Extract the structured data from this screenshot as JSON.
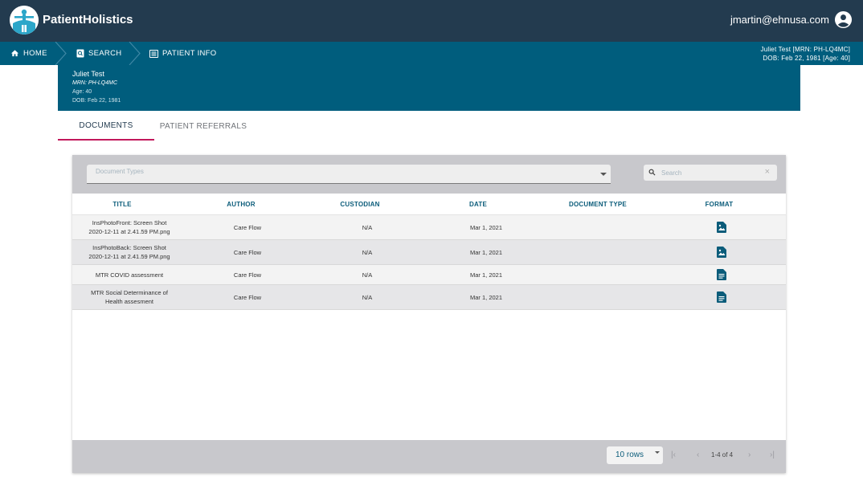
{
  "header": {
    "brand": "PatientHolistics",
    "user_email": "jmartin@ehnusa.com"
  },
  "nav": {
    "home": "HOME",
    "search": "SEARCH",
    "patient_info": "PATIENT INFO",
    "patient_line1": "Juliet Test [MRN: PH-LQ4MC]",
    "patient_line2": "DOB: Feb 22, 1981 [Age: 40]"
  },
  "patient": {
    "name": "Juliet Test",
    "mrn": "MRN: PH-LQ4MC",
    "age": "Age: 40",
    "dob": "DOB: Feb 22, 1981"
  },
  "tabs": [
    {
      "label": "DOCUMENTS",
      "active": true
    },
    {
      "label": "PATIENT REFERRALS",
      "active": false
    }
  ],
  "filters": {
    "doc_types_placeholder": "Document Types",
    "search_placeholder": "Search"
  },
  "table": {
    "columns": [
      "TITLE",
      "AUTHOR",
      "CUSTODIAN",
      "DATE",
      "DOCUMENT TYPE",
      "FORMAT"
    ],
    "rows": [
      {
        "title_1": "InsPhotoFront: Screen Shot",
        "title_2": "2020-12-11 at 2.41.59 PM.png",
        "author": "Care Flow",
        "custodian": "N/A",
        "date": "Mar 1, 2021",
        "doc_type": "",
        "format": "image-file-icon"
      },
      {
        "title_1": "InsPhotoBack: Screen Shot",
        "title_2": "2020-12-11 at 2.41.59 PM.png",
        "author": "Care Flow",
        "custodian": "N/A",
        "date": "Mar 1, 2021",
        "doc_type": "",
        "format": "image-file-icon"
      },
      {
        "title_1": "MTR COVID assessment",
        "title_2": "",
        "author": "Care Flow",
        "custodian": "N/A",
        "date": "Mar 1, 2021",
        "doc_type": "",
        "format": "document-icon"
      },
      {
        "title_1": "MTR Social Determinance of",
        "title_2": "Health assesment",
        "author": "Care Flow",
        "custodian": "N/A",
        "date": "Mar 1, 2021",
        "doc_type": "",
        "format": "document-icon"
      }
    ]
  },
  "pagination": {
    "rows_label": "10 rows",
    "range": "1-4 of 4"
  },
  "colors": {
    "topbar": "#233b4f",
    "navbar": "#005d7d",
    "accent": "#c2185b",
    "header_text": "#0b5c7a"
  }
}
